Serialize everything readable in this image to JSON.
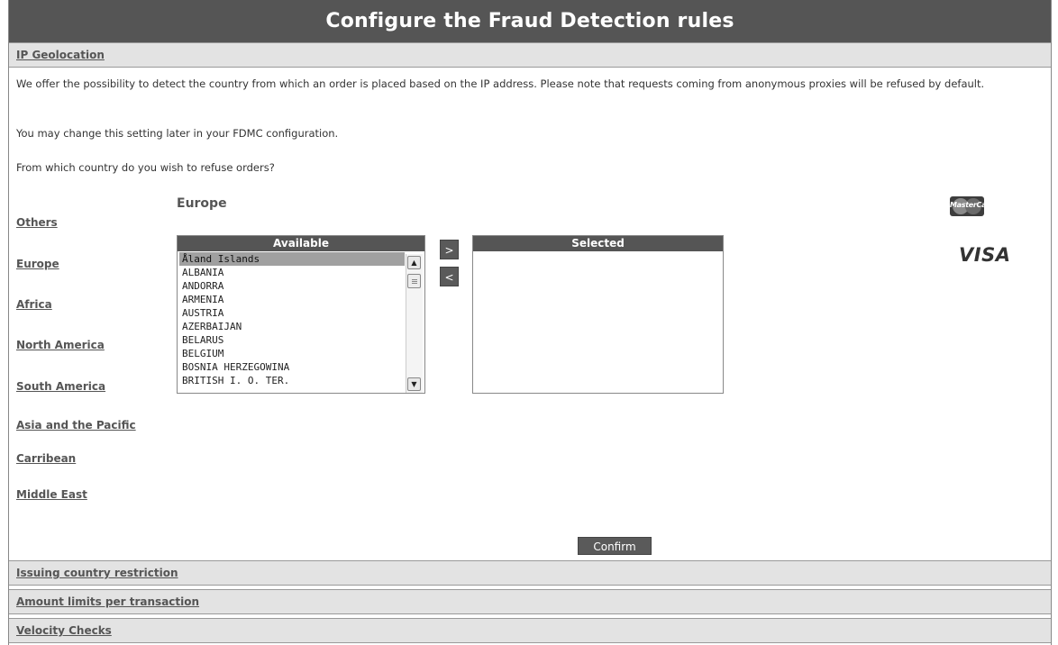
{
  "page": {
    "title": "Configure the Fraud Detection rules"
  },
  "sections": {
    "ip_geolocation": "IP Geolocation",
    "issuing_country": "Issuing country restriction",
    "amount_limits": "Amount limits per transaction",
    "velocity_checks": "Velocity Checks"
  },
  "intro": {
    "paragraph1": "We offer the possibility to detect the country from which an order is placed based on the IP address. Please note that requests coming from anonymous proxies will be refused by default.",
    "paragraph2": "You may change this setting later in your FDMC configuration.",
    "question": "From which country do you wish to refuse orders?"
  },
  "regions": [
    {
      "label": "Others"
    },
    {
      "label": "Europe"
    },
    {
      "label": "Africa"
    },
    {
      "label": "North America"
    },
    {
      "label": "South America"
    },
    {
      "label": "Asia and the Pacific"
    },
    {
      "label": "Carribean"
    },
    {
      "label": "Middle East"
    }
  ],
  "selected_region": "Europe",
  "available": {
    "header": "Available",
    "items": [
      "Åland Islands",
      "ALBANIA",
      "ANDORRA",
      "ARMENIA",
      "AUSTRIA",
      "AZERBAIJAN",
      "BELARUS",
      "BELGIUM",
      "BOSNIA HERZEGOWINA",
      "BRITISH I. O. TER."
    ],
    "highlighted": "Åland Islands"
  },
  "selected": {
    "header": "Selected",
    "items": []
  },
  "buttons": {
    "add": ">",
    "remove": "<",
    "confirm": "Confirm"
  },
  "logos": {
    "mastercard": "MasterCard",
    "visa": "VISA"
  },
  "colors": {
    "header_bg": "#555555",
    "section_bg": "#e3e3e3",
    "button_bg": "#5a5a5a",
    "selection_bg": "#a0a0a0"
  }
}
